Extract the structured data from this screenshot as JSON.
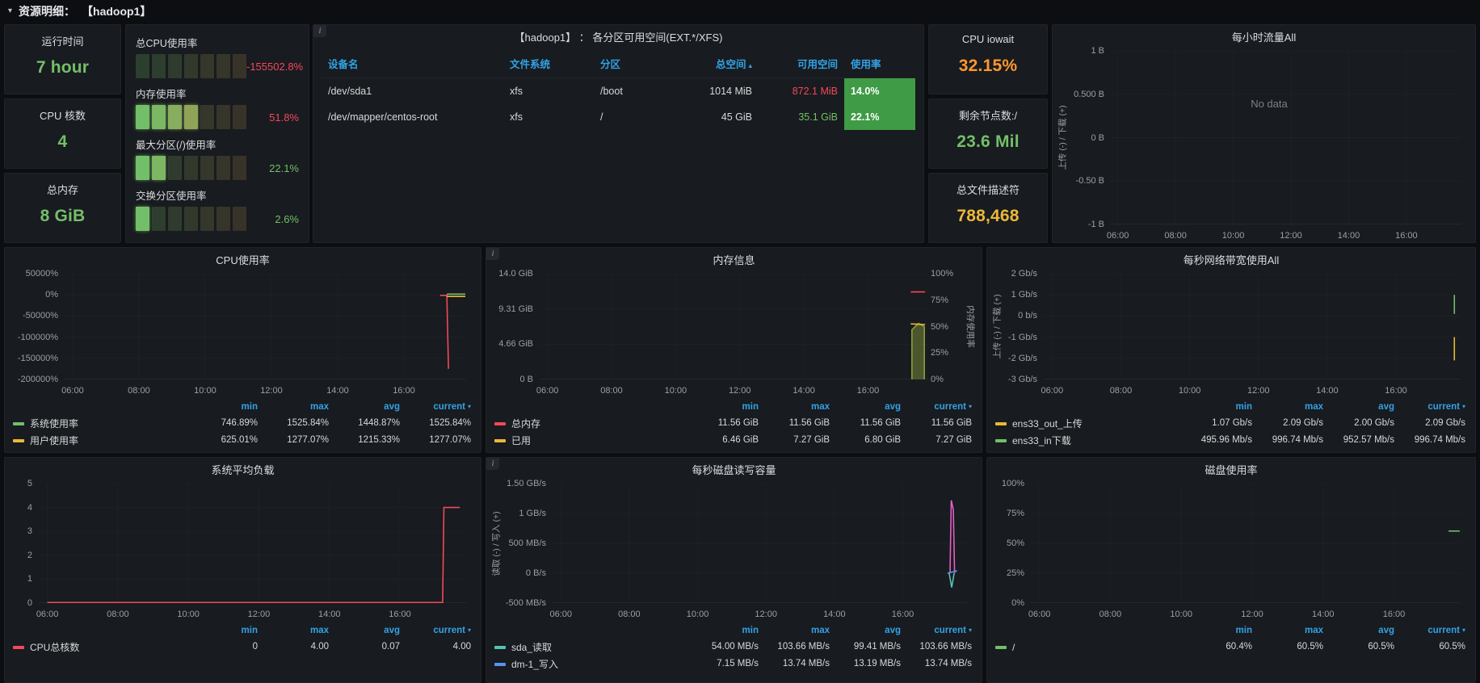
{
  "icons": {
    "chevron_down": "▾",
    "caret_up": "▴",
    "caret_down": "▾",
    "info": "i"
  },
  "topbar": {
    "label": "资源明细：",
    "target": "【hadoop1】"
  },
  "layout": {
    "x_fracs": [
      0.02,
      0.185,
      0.35,
      0.515,
      0.68,
      0.845
    ]
  },
  "charts_common": {
    "x_ticks": [
      "06:00",
      "08:00",
      "10:00",
      "12:00",
      "14:00",
      "16:00"
    ],
    "legend_columns": [
      "min",
      "max",
      "avg",
      "current"
    ]
  },
  "stats": {
    "uptime": {
      "title": "运行时间",
      "value": "7 hour",
      "color": "#73bf69"
    },
    "cores": {
      "title": "CPU 核数",
      "value": "4",
      "color": "#73bf69"
    },
    "total_mem": {
      "title": "总内存",
      "value": "8 GiB",
      "color": "#73bf69"
    },
    "cpu_iowait": {
      "title": "CPU iowait",
      "value": "32.15%",
      "color": "#ff9830"
    },
    "remaining_nodes": {
      "title": "剩余节点数:/",
      "value": "23.6 Mil",
      "color": "#73bf69"
    },
    "file_descriptors": {
      "title": "总文件描述符",
      "value": "788,468",
      "color": "#eab839"
    }
  },
  "gauges": {
    "segments_total": 7,
    "segment_colors": [
      "#73bf69",
      "#7cb763",
      "#86ae5e",
      "#90a458",
      "#9a9b52",
      "#a4924c",
      "#ae8847"
    ],
    "items": [
      {
        "label": "总CPU使用率",
        "value": "-155502.8%",
        "value_color": "#f2495c",
        "lit": 0
      },
      {
        "label": "内存使用率",
        "value": "51.8%",
        "value_color": "#f2495c",
        "lit": 4
      },
      {
        "label": "最大分区(/)使用率",
        "value": "22.1%",
        "value_color": "#73bf69",
        "lit": 2
      },
      {
        "label": "交换分区使用率",
        "value": "2.6%",
        "value_color": "#73bf69",
        "lit": 1
      }
    ]
  },
  "partition_table": {
    "title": "【hadoop1】 ：  各分区可用空间(EXT.*/XFS)",
    "columns": [
      {
        "label": "设备名"
      },
      {
        "label": "文件系统"
      },
      {
        "label": "分区"
      },
      {
        "label": "总空间",
        "sort": true
      },
      {
        "label": "可用空间"
      },
      {
        "label": "使用率"
      }
    ],
    "rows": [
      [
        {
          "text": "/dev/sda1"
        },
        {
          "text": "xfs"
        },
        {
          "text": "/boot"
        },
        {
          "text": "1014 MiB"
        },
        {
          "text": "872.1 MiB",
          "color": "#f2495c"
        },
        {
          "text": "14.0%",
          "bg": "#3f9b45"
        }
      ],
      [
        {
          "text": "/dev/mapper/centos-root"
        },
        {
          "text": "xfs"
        },
        {
          "text": "/"
        },
        {
          "text": "45 GiB"
        },
        {
          "text": "35.1 GiB",
          "color": "#73bf69"
        },
        {
          "text": "22.1%",
          "bg": "#3f9b45"
        }
      ]
    ]
  },
  "charts": {
    "hourly": {
      "title": "每小时流量All",
      "y_label": "上传 (-) / 下载 (+)",
      "y_ticks": [
        "1 B",
        "0.500 B",
        "0 B",
        "-0.50 B",
        "-1 B"
      ],
      "no_data": "No data",
      "series_draw": []
    },
    "cpu": {
      "title": "CPU使用率",
      "y_ticks": [
        "50000%",
        "0%",
        "-50000%",
        "-100000%",
        "-150000%",
        "-200000%"
      ],
      "series_draw": [
        {
          "color": "#f2495c",
          "points": [
            [
              0.935,
              0.205
            ],
            [
              0.952,
              0.205
            ],
            [
              0.956,
              0.9
            ]
          ]
        },
        {
          "color": "#eab839",
          "points": [
            [
              0.952,
              0.215
            ],
            [
              0.998,
              0.215
            ]
          ]
        },
        {
          "color": "#73bf69",
          "points": [
            [
              0.952,
              0.193
            ],
            [
              0.998,
              0.193
            ]
          ]
        }
      ],
      "legend": {
        "rows": [
          {
            "label": "系统使用率",
            "color": "#73bf69",
            "values": [
              "746.89%",
              "1525.84%",
              "1448.87%",
              "1525.84%"
            ]
          },
          {
            "label": "用户使用率",
            "color": "#eab839",
            "values": [
              "625.01%",
              "1277.07%",
              "1215.33%",
              "1277.07%"
            ]
          }
        ]
      }
    },
    "mem": {
      "title": "内存信息",
      "y_ticks": [
        "14.0 GiB",
        "9.31 GiB",
        "4.66 GiB",
        "0 B"
      ],
      "right_y_ticks": [
        "100%",
        "75%",
        "50%",
        "25%",
        "0%"
      ],
      "y_label_right": "内存使用率",
      "series_draw": [
        {
          "color": "#8a9e3c",
          "fill": "rgba(140,160,60,0.45)",
          "points": [
            [
              0.958,
              0.999
            ],
            [
              0.958,
              0.53
            ],
            [
              0.975,
              0.47
            ],
            [
              0.99,
              0.5
            ],
            [
              0.99,
              0.999
            ]
          ]
        },
        {
          "color": "#f2495c",
          "points": [
            [
              0.955,
              0.172
            ],
            [
              0.992,
              0.172
            ]
          ]
        },
        {
          "color": "#eab839",
          "points": [
            [
              0.955,
              0.475
            ],
            [
              0.992,
              0.481
            ]
          ]
        }
      ],
      "legend": {
        "rows": [
          {
            "label": "总内存",
            "color": "#f2495c",
            "values": [
              "11.56 GiB",
              "11.56 GiB",
              "11.56 GiB",
              "11.56 GiB"
            ]
          },
          {
            "label": "已用",
            "color": "#eab839",
            "values": [
              "6.46 GiB",
              "7.27 GiB",
              "6.80 GiB",
              "7.27 GiB"
            ]
          }
        ]
      }
    },
    "net": {
      "title": "每秒网络带宽使用All",
      "y_label": "上传 (-) / 下载 (+)",
      "y_ticks": [
        "2 Gb/s",
        "1 Gb/s",
        "0 b/s",
        "-1 Gb/s",
        "-2 Gb/s",
        "-3 Gb/s"
      ],
      "series_draw": [
        {
          "color": "#73bf69",
          "points": [
            [
              0.985,
              0.2
            ],
            [
              0.985,
              0.38
            ]
          ]
        },
        {
          "color": "#eab839",
          "points": [
            [
              0.985,
              0.6
            ],
            [
              0.985,
              0.82
            ]
          ]
        }
      ],
      "legend": {
        "rows": [
          {
            "label": "ens33_out_上传",
            "color": "#eab839",
            "values": [
              "1.07 Gb/s",
              "2.09 Gb/s",
              "2.00 Gb/s",
              "2.09 Gb/s"
            ]
          },
          {
            "label": "ens33_in下载",
            "color": "#73bf69",
            "values": [
              "495.96 Mb/s",
              "996.74 Mb/s",
              "952.57 Mb/s",
              "996.74 Mb/s"
            ]
          }
        ]
      }
    },
    "load": {
      "title": "系统平均负载",
      "y_ticks": [
        "5",
        "4",
        "3",
        "2",
        "1",
        "0"
      ],
      "series_draw": [
        {
          "color": "#f2495c",
          "points": [
            [
              0.02,
              0.995
            ],
            [
              0.945,
              0.995
            ],
            [
              0.948,
              0.2
            ],
            [
              0.985,
              0.2
            ]
          ]
        }
      ],
      "legend": {
        "rows": [
          {
            "label": "CPU总核数",
            "color": "#f2495c",
            "values": [
              "0",
              "4.00",
              "0.07",
              "4.00"
            ]
          }
        ]
      }
    },
    "disk_rw": {
      "title": "每秒磁盘读写容量",
      "y_label": "读取 (-) / 写入 (+)",
      "y_ticks": [
        "1.50 GB/s",
        "1 GB/s",
        "500 MB/s",
        "0 B/s",
        "-500 MB/s"
      ],
      "series_draw": [
        {
          "color": "#e05fc6",
          "points": [
            [
              0.959,
              0.75
            ],
            [
              0.962,
              0.14
            ],
            [
              0.967,
              0.22
            ],
            [
              0.97,
              0.75
            ]
          ]
        },
        {
          "color": "#5794f2",
          "points": [
            [
              0.953,
              0.75
            ],
            [
              0.976,
              0.73
            ]
          ]
        },
        {
          "color": "#56c2b0",
          "points": [
            [
              0.957,
              0.75
            ],
            [
              0.963,
              0.87
            ],
            [
              0.969,
              0.75
            ]
          ]
        }
      ],
      "legend": {
        "rows": [
          {
            "label": "sda_读取",
            "color": "#56c2b0",
            "values": [
              "54.00 MB/s",
              "103.66 MB/s",
              "99.41 MB/s",
              "103.66 MB/s"
            ]
          },
          {
            "label": "dm-1_写入",
            "color": "#5794f2",
            "values": [
              "7.15 MB/s",
              "13.74 MB/s",
              "13.19 MB/s",
              "13.74 MB/s"
            ]
          }
        ]
      }
    },
    "disk_usage": {
      "title": "磁盘使用率",
      "y_ticks": [
        "100%",
        "75%",
        "50%",
        "25%",
        "0%"
      ],
      "series_draw": [
        {
          "color": "#73bf69",
          "points": [
            [
              0.972,
              0.397
            ],
            [
              0.998,
              0.397
            ]
          ]
        }
      ],
      "legend": {
        "rows": [
          {
            "label": "/",
            "color": "#73bf69",
            "values": [
              "60.4%",
              "60.5%",
              "60.5%",
              "60.5%"
            ]
          }
        ]
      }
    }
  }
}
